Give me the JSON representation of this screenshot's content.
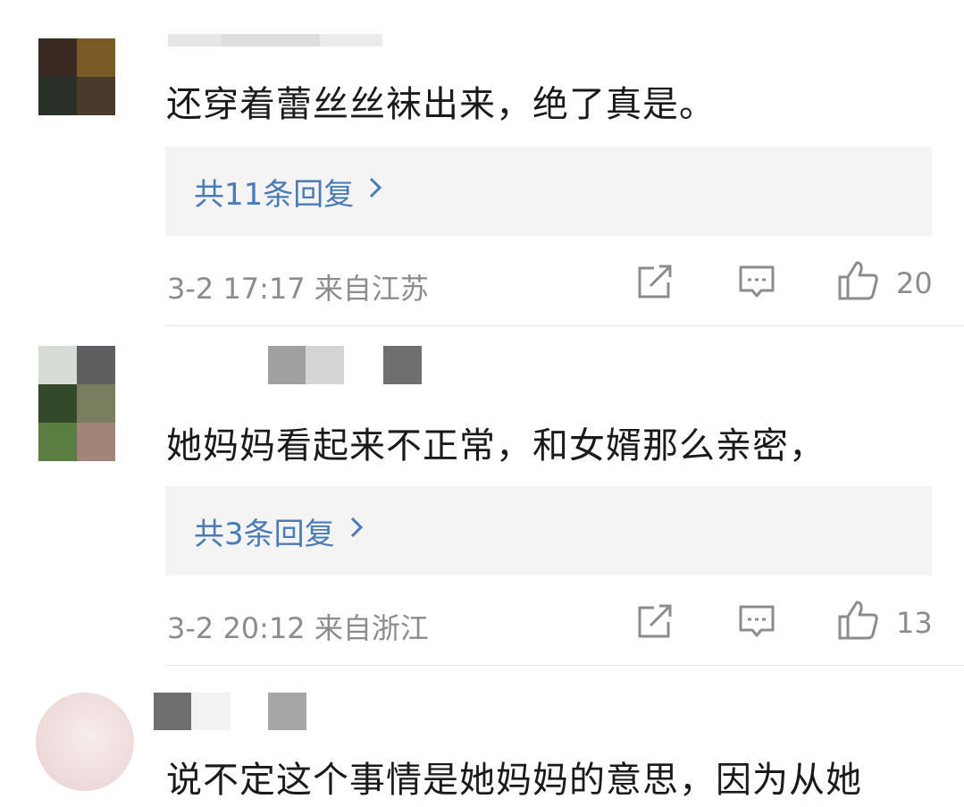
{
  "comments": [
    {
      "text": "还穿着蕾丝丝袜出来，绝了真是。",
      "reply_link": "共11条回复",
      "meta": "3-2 17:17  来自江苏",
      "like_count": "20",
      "avatar_colors": [
        "#3a2a24",
        "#7a5a25",
        "#2a3128",
        "#4a3a2c"
      ]
    },
    {
      "text": "她妈妈看起来不正常，和女婿那么亲密，",
      "reply_link": "共3条回复",
      "meta": "3-2 20:12  来自浙江",
      "like_count": "13",
      "avatar_colors": [
        "#d8dcd6",
        "#5f5f62",
        "#324a2a",
        "#7a7d5e",
        "#5a7d42",
        "#a08478"
      ]
    },
    {
      "text": "说不定这个事情是她妈妈的意思，因为从她"
    }
  ],
  "icons": {
    "share": "share-icon",
    "comment": "comment-icon",
    "like": "thumbs-up-icon",
    "chevron": "chevron-right-icon"
  },
  "colors": {
    "link": "#4a7bb5",
    "meta": "#8c8c8c",
    "reply_bg": "#f4f4f4"
  }
}
